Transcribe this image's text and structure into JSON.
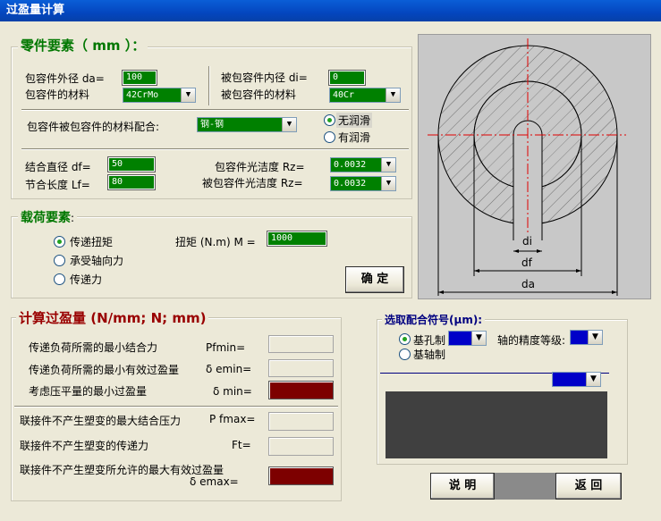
{
  "window": {
    "title": "过盈量计算"
  },
  "parts": {
    "title": "零件要素（ mm ）：",
    "outer_dia_label": "包容件外径 da=",
    "outer_dia_value": "100",
    "inner_dia_label": "被包容件内径 di=",
    "inner_dia_value": "0",
    "hub_material_label": "包容件的材料",
    "hub_material_value": "42CrMo",
    "shaft_material_label": "被包容件的材料",
    "shaft_material_value": "40Cr",
    "pairing_label": "包容件被包容件的材料配合:",
    "pairing_value": "钢-钢",
    "lube_options": [
      "无润滑",
      "有润滑"
    ],
    "mating_dia_label": "结合直径 df=",
    "mating_dia_value": "50",
    "fit_length_label": "节合长度 Lf=",
    "fit_length_value": "80",
    "hub_finish_label": "包容件光洁度  Rz=",
    "hub_finish_value": "0.0032",
    "shaft_finish_label": "被包容件光洁度  Rz=",
    "shaft_finish_value": "0.0032"
  },
  "load": {
    "title": "载荷要素",
    "colon": ":",
    "options": [
      "传递扭矩",
      "承受轴向力",
      "传递力"
    ],
    "torque_label": "扭矩 (N.m) M =",
    "torque_value": "1000",
    "confirm_label": "确 定"
  },
  "diagram": {
    "di_label": "di",
    "df_label": "df",
    "da_label": "da",
    "colors": {
      "bg": "#c8c8c8",
      "centerline": "#e00000"
    }
  },
  "calc": {
    "title": "计算过盈量 (N/mm; N; mm)",
    "rows": [
      {
        "label": "传递负荷所需的最小结合力",
        "symbol": "Pfmin="
      },
      {
        "label": "传递负荷所需的最小有效过盈量",
        "symbol": "δ emin="
      },
      {
        "label": "考虑压平量的最小过盈量",
        "symbol": "δ min="
      },
      {
        "label": "联接件不产生塑变的最大结合压力",
        "symbol": "P fmax="
      },
      {
        "label": "联接件不产生塑变的传递力",
        "symbol": "Ft="
      },
      {
        "label": "联接件不产生塑变所允许的最大有效过盈量",
        "symbol": "δ emax="
      }
    ]
  },
  "fit": {
    "title": "选取配合符号(μm):",
    "options": [
      "基孔制",
      "基轴制"
    ],
    "grade_label": "轴的精度等级:",
    "colors": {
      "combo": "#0000c8",
      "result_box": "#404040"
    }
  },
  "footer": {
    "help_label": "说 明",
    "back_label": "返 回"
  }
}
